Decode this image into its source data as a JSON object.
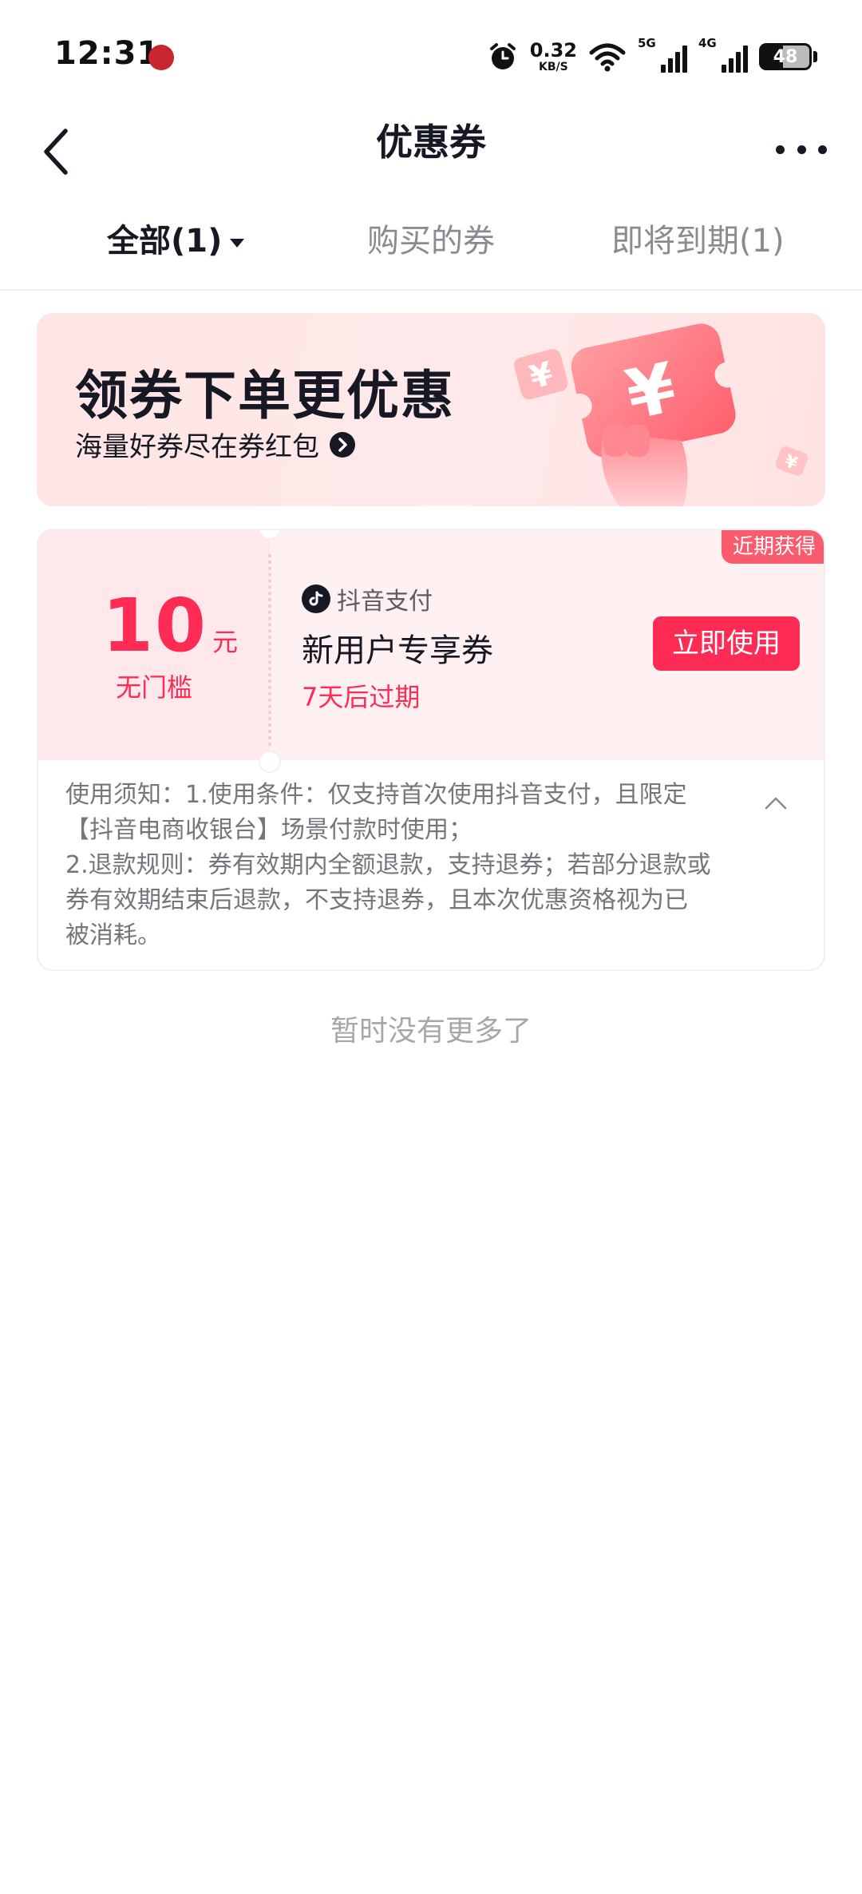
{
  "status_bar": {
    "time": "12:31",
    "net_speed_value": "0.32",
    "net_speed_unit": "KB/S",
    "signal_1_tag": "5G",
    "signal_2_tag": "4G",
    "battery": "48"
  },
  "nav": {
    "title": "优惠券"
  },
  "tabs": [
    {
      "label": "全部(1)",
      "active": true
    },
    {
      "label": "购买的券",
      "active": false
    },
    {
      "label": "即将到期(1)",
      "active": false
    }
  ],
  "banner": {
    "title": "领券下单更优惠",
    "subtitle": "海量好券尽在券红包"
  },
  "coupon": {
    "amount": "10",
    "unit": "元",
    "threshold": "无门槛",
    "badge": "近期获得",
    "provider": "抖音支付",
    "name": "新用户专享券",
    "expiry": "7天后过期",
    "button": "立即使用",
    "notes": [
      "使用须知：1.使用条件：仅支持首次使用抖音支付，且限定",
      "【抖音电商收银台】场景付款时使用；",
      "2.退款规则：券有效期内全额退款，支持退券；若部分退款或",
      "券有效期结束后退款，不支持退券，且本次优惠资格视为已",
      "被消耗。"
    ]
  },
  "footer": {
    "no_more": "暂时没有更多了"
  },
  "colors": {
    "accent": "#fe2c55",
    "badge": "#fa5c6e",
    "muted": "#8a8b91"
  },
  "icons": {
    "back": "chevron-left-icon",
    "more": "more-dots-icon",
    "alarm": "alarm-icon",
    "wifi": "wifi-icon",
    "provider": "douyin-logo-icon",
    "collapse": "chevron-up-icon",
    "banner_arrow": "arrow-circle-icon"
  }
}
